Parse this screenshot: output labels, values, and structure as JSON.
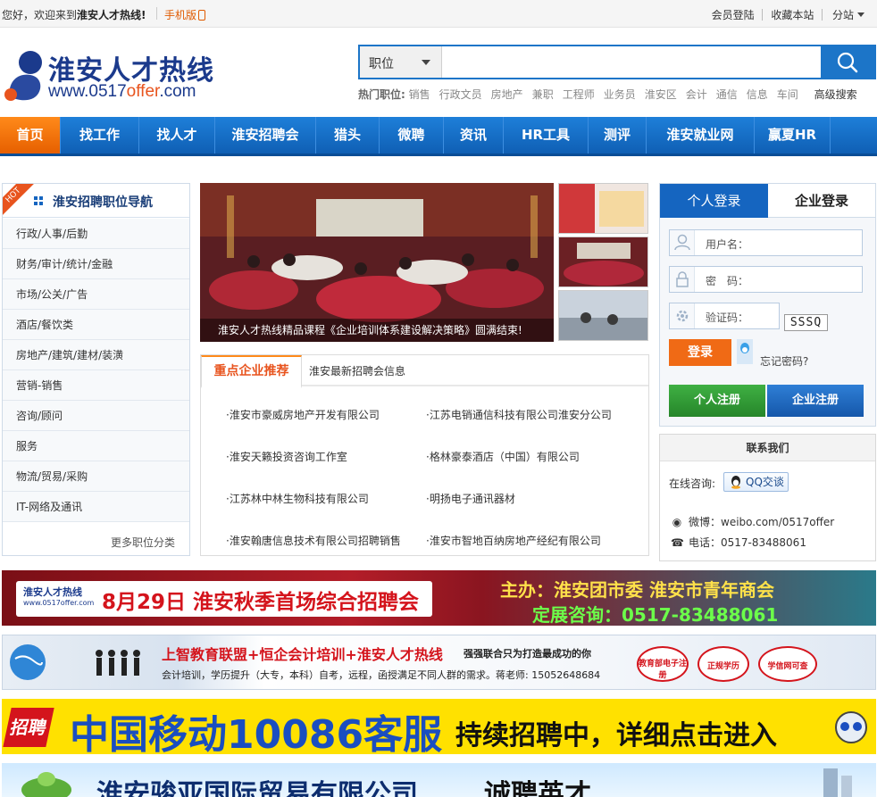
{
  "topbar": {
    "welcome_prefix": "您好，欢迎来到",
    "welcome_site": "淮安人才热线!",
    "mobile": "手机版",
    "member_login": "会员登陆",
    "favorite": "收藏本站",
    "branch": "分站"
  },
  "logo": {
    "name": "淮安人才热线",
    "url_prefix": "www.0517",
    "url_accent": "offer",
    "url_suffix": ".com"
  },
  "search": {
    "type": "职位",
    "placeholder": ""
  },
  "hot": {
    "label": "热门职位:",
    "keywords": [
      "销售",
      "行政文员",
      "房地产",
      "兼职",
      "工程师",
      "业务员",
      "淮安区",
      "会计",
      "通信",
      "信息",
      "车间"
    ],
    "advanced": "高级搜索"
  },
  "nav": {
    "items": [
      "首页",
      "找工作",
      "找人才",
      "淮安招聘会",
      "猎头",
      "微聘",
      "资讯",
      "HR工具",
      "测评",
      "淮安就业网",
      "赢夏HR"
    ]
  },
  "category": {
    "badge": "HOT",
    "title": "淮安招聘职位导航",
    "items": [
      "行政/人事/后勤",
      "财务/审计/统计/金融",
      "市场/公关/广告",
      "酒店/餐饮类",
      "房地产/建筑/建材/装潢",
      "营销-销售",
      "咨询/顾问",
      "服务",
      "物流/贸易/采购",
      "IT-网络及通讯"
    ],
    "more": "更多职位分类"
  },
  "slider": {
    "caption": "淮安人才热线精品课程《企业培训体系建设解决策略》圆满结束!"
  },
  "recommend": {
    "tab_active": "重点企业推荐",
    "tab_other": "淮安最新招聘会信息",
    "companies": [
      "·淮安市豪威房地产开发有限公司",
      "·江苏电销通信科技有限公司淮安分公司",
      "·淮安天籁投资咨询工作室",
      "·格林豪泰酒店（中国）有限公司",
      "·江苏林中林生物科技有限公司",
      "·明扬电子通讯器材",
      "·淮安翰唐信息技术有限公司招聘销售",
      "·淮安市智地百纳房地产经纪有限公司"
    ]
  },
  "login": {
    "tab_personal": "个人登录",
    "tab_company": "企业登录",
    "username": "用户名：",
    "password": "密　码：",
    "captcha": "验证码：",
    "captcha_code": "SSSQ",
    "submit": "登录",
    "forgot": "忘记密码?",
    "reg_personal": "个人注册",
    "reg_company": "企业注册"
  },
  "contact": {
    "title": "联系我们",
    "online_label": "在线咨询:",
    "qq_button": "QQ交谈",
    "weibo": "微博：weibo.com/0517offer",
    "phone": "电话：0517-83488061"
  },
  "banners": {
    "b1_logo": "淮安人才热线",
    "b1_logo_url": "www.0517offer.com",
    "b1_title": "8月29日 淮安秋季首场综合招聘会",
    "b1_host": "主办：淮安团市委 淮安市青年商会",
    "b1_contact": "定展咨询：0517-83488061",
    "b2_title": "上智教育联盟+恒企会计培训+淮安人才热线",
    "b2_slogan": "强强联合只为打造最成功的你",
    "b2_desc": "会计培训，学历提升（大专，本科）自考，远程，函授满足不同人群的需求。蒋老师: 15052648684",
    "b2_badges": [
      "教育部电子注册",
      "正规学历",
      "学信网可查"
    ],
    "b3_tag": "招聘",
    "b3_title": "中国移动10086客服",
    "b3_sub": "持续招聘中，详细点击进入",
    "b4_title": "淮安骏亚国际贸易有限公司",
    "b4_sub": "诚聘英才"
  },
  "colors": {
    "brand_blue": "#1565c0",
    "accent_orange": "#f06a15",
    "nav_active": "#ff8a1a"
  }
}
